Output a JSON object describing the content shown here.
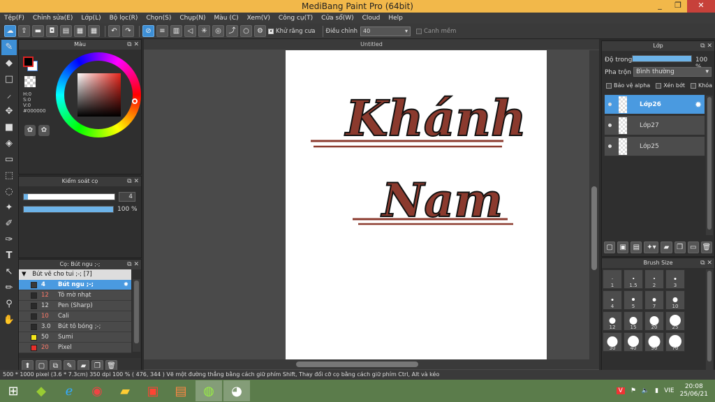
{
  "window": {
    "title": "MediBang Paint Pro (64bit)",
    "min": "_",
    "max": "❐",
    "close": "✕"
  },
  "menu": [
    "Tệp(F)",
    "Chỉnh sửa(E)",
    "Lớp(L)",
    "Bộ lọc(R)",
    "Chọn(S)",
    "Chụp(N)",
    "Màu (C)",
    "Xem(V)",
    "Công cụ(T)",
    "Cửa sổ(W)",
    "Cloud",
    "Help"
  ],
  "toolbar": {
    "antialias_label": "Khử răng cưa",
    "correction_label": "Điều chỉnh",
    "correction_value": "40",
    "snap_label": "Canh mềm"
  },
  "color_panel": {
    "title": "Màu",
    "hsv_h": "H:0",
    "hsv_s": "S:0",
    "hsv_v": "V:0",
    "hex": "#000000",
    "fg_color": "#000000",
    "bg_color": "#ffffff"
  },
  "brush_control": {
    "title": "Kiểm soát cọ",
    "size_value": "4",
    "opacity_value": "100 %"
  },
  "brush_list": {
    "title": "Cọ: Bút ngu ;-;",
    "group": "Bút vẽ cho tui ;-; [7]",
    "items": [
      {
        "size": "4",
        "name": "Bút ngu ;-;",
        "color": "#3a3a3a",
        "size_color": "#ffffff",
        "selected": true
      },
      {
        "size": "12",
        "name": "Tô mờ nhạt",
        "color": "#2a2a2a",
        "size_color": "#ff7a6a",
        "selected": false
      },
      {
        "size": "12",
        "name": "Pen (Sharp)",
        "color": "#2a2a2a",
        "size_color": "#dddddd",
        "selected": false
      },
      {
        "size": "10",
        "name": "Cali",
        "color": "#2a2a2a",
        "size_color": "#ff7a6a",
        "selected": false
      },
      {
        "size": "3.0",
        "name": "Bút tô bóng ;-;",
        "color": "#2a2a2a",
        "size_color": "#dddddd",
        "selected": false
      },
      {
        "size": "50",
        "name": "Sumi",
        "color": "#f5e61a",
        "size_color": "#dddddd",
        "selected": false
      },
      {
        "size": "20",
        "name": "Pixel",
        "color": "#e8302a",
        "size_color": "#ff7a6a",
        "selected": false
      }
    ]
  },
  "canvas": {
    "tab": "Untitled",
    "text_line1": "Khánh",
    "text_line2": "Nam",
    "ink_color": "#8b3a2e"
  },
  "layer_panel": {
    "title": "Lớp",
    "opacity_label": "Độ trong",
    "opacity_value": "100 %",
    "blend_label": "Pha trộn",
    "blend_value": "Bình thường",
    "protect_alpha": "Bảo vệ alpha",
    "clipping": "Xén bớt",
    "lock": "Khóa",
    "layers": [
      {
        "name": "Lớp26",
        "selected": true
      },
      {
        "name": "Lớp27",
        "selected": false
      },
      {
        "name": "Lớp25",
        "selected": false
      }
    ]
  },
  "brush_size_panel": {
    "title": "Brush Size",
    "sizes": [
      "1",
      "1.5",
      "2",
      "3",
      "4",
      "5",
      "7",
      "10",
      "12",
      "15",
      "20",
      "25",
      "30",
      "40",
      "50",
      "70"
    ]
  },
  "status": {
    "text": "500 * 1000 pixel   (3.6 * 7.3cm)   350 dpi   100 %   ( 476, 344 )   Vẽ một đường thẳng bằng cách giữ phím Shift, Thay đổi cỡ cọ bằng cách giữ phím Ctrl, Alt và kéo"
  },
  "taskbar": {
    "lang": "VIE",
    "time": "20:08",
    "date": "25/06/21"
  }
}
